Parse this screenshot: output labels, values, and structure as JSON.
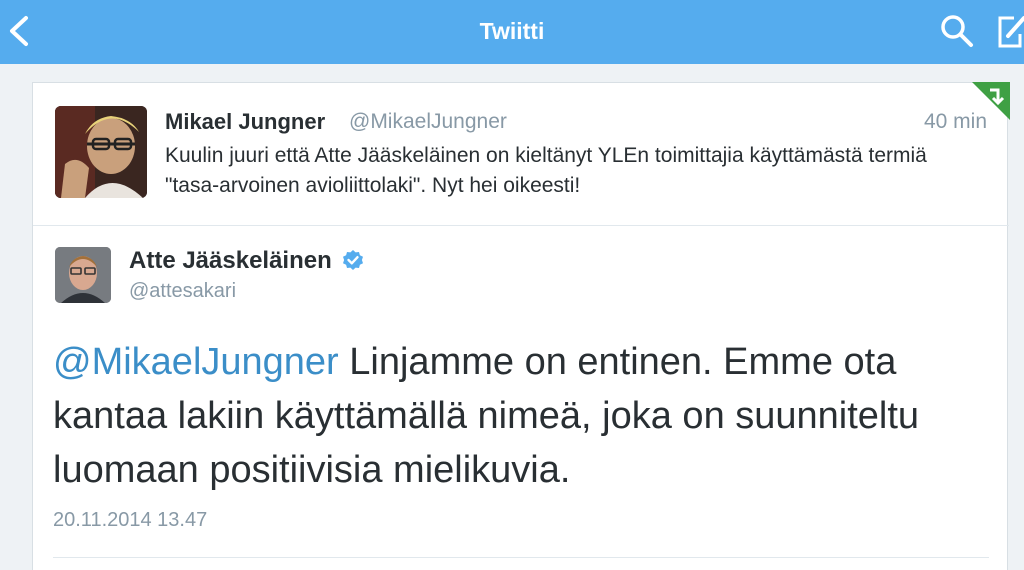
{
  "nav": {
    "title": "Twiitti",
    "back_icon": "chevron-left-icon",
    "search_icon": "search-icon",
    "compose_icon": "compose-icon",
    "bar_color": "#55acee"
  },
  "parent_tweet": {
    "name": "Mikael Jungner",
    "handle": "@MikaelJungner",
    "time": "40 min",
    "text": "Kuulin juuri että Atte Jääskeläinen on kieltänyt YLEn toimittajia käyttämästä termiä \"tasa-arvoinen avioliittolaki\". Nyt hei oikeesti!"
  },
  "main_tweet": {
    "name": "Atte Jääskeläinen",
    "verified": true,
    "handle": "@attesakari",
    "mention": "@MikaelJungner",
    "text": " Linjamme on entinen. Emme ota kantaa lakiin käyttämällä nimeä, joka on suunniteltu luomaan positiivisia mielikuvia.",
    "timestamp": "20.11.2014 13.47"
  },
  "colors": {
    "accent": "#55acee",
    "mention": "#3b8ec8",
    "verified": "#55acee",
    "corner_badge": "#3fa044"
  }
}
